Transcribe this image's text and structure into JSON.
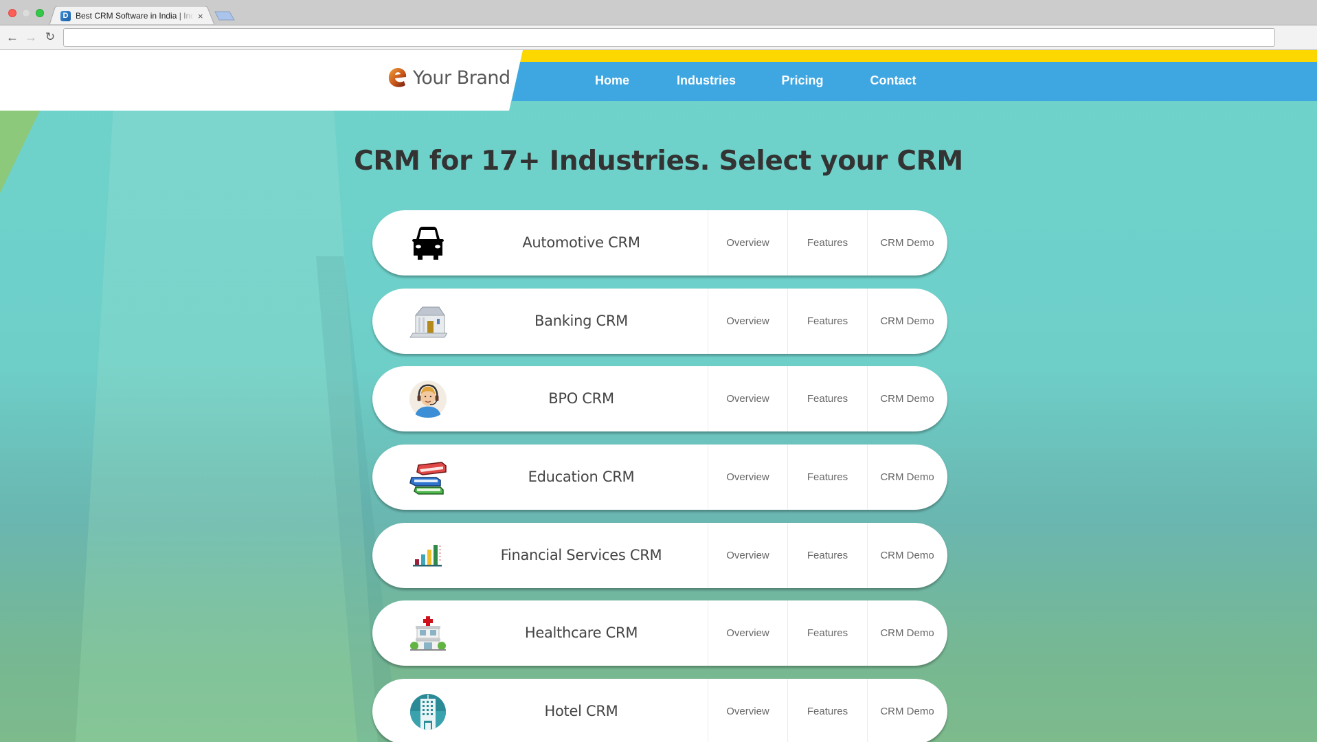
{
  "browser": {
    "tab_title": "Best CRM Software in India | Industry CRM",
    "favicon_letter": "D",
    "tab_close": "×",
    "url": ""
  },
  "brand": {
    "name": "Your Brand"
  },
  "nav": {
    "items": [
      {
        "label": "Home"
      },
      {
        "label": "Industries"
      },
      {
        "label": "Pricing"
      },
      {
        "label": "Contact"
      }
    ]
  },
  "main": {
    "headline": "CRM for 17+ Industries. Select your CRM",
    "rows": [
      {
        "name": "Automotive CRM",
        "icon": "car-icon",
        "links": [
          "Overview",
          "Features",
          "CRM Demo"
        ]
      },
      {
        "name": "Banking CRM",
        "icon": "bank-icon",
        "links": [
          "Overview",
          "Features",
          "CRM Demo"
        ]
      },
      {
        "name": "BPO CRM",
        "icon": "call-agent-icon",
        "links": [
          "Overview",
          "Features",
          "CRM Demo"
        ]
      },
      {
        "name": "Education CRM",
        "icon": "books-icon",
        "links": [
          "Overview",
          "Features",
          "CRM Demo"
        ]
      },
      {
        "name": "Financial Services CRM",
        "icon": "bar-chart-icon",
        "links": [
          "Overview",
          "Features",
          "CRM Demo"
        ]
      },
      {
        "name": "Healthcare CRM",
        "icon": "hospital-icon",
        "links": [
          "Overview",
          "Features",
          "CRM Demo"
        ]
      },
      {
        "name": "Hotel CRM",
        "icon": "hotel-icon",
        "links": [
          "Overview",
          "Features",
          "CRM Demo"
        ]
      }
    ]
  },
  "colors": {
    "nav_blue": "#3ea6e1",
    "accent_yellow": "#fcd800",
    "background_teal": "#6fd3cb",
    "headline": "#333333"
  }
}
